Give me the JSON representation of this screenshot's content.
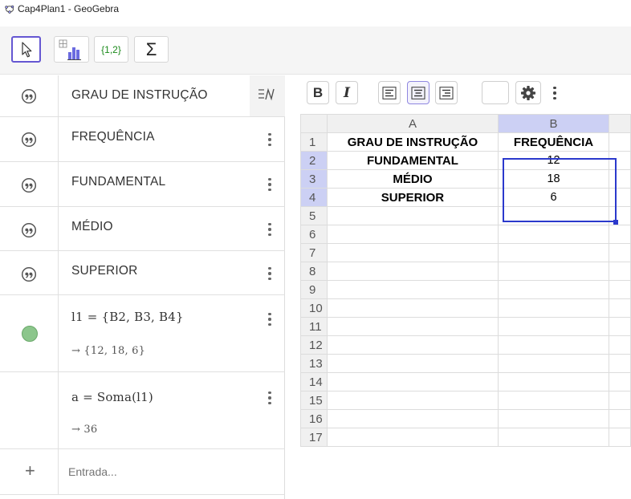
{
  "window": {
    "title": "Cap4Plan1 - GeoGebra"
  },
  "toolbar": {
    "tools": [
      {
        "name": "move",
        "icon": "cursor-arrow-icon",
        "active": true
      },
      {
        "name": "chart",
        "icon": "bar-chart-icon"
      },
      {
        "name": "list",
        "icon": "list-icon",
        "label": "{1,2}"
      },
      {
        "name": "sum",
        "icon": "sigma-icon",
        "label": "Σ"
      }
    ]
  },
  "algebra": {
    "items": [
      {
        "icon": "quote-icon",
        "text": "GRAU DE INSTRUÇÃO"
      },
      {
        "icon": "quote-icon",
        "text": "FREQUÊNCIA"
      },
      {
        "icon": "quote-icon",
        "text": "FUNDAMENTAL"
      },
      {
        "icon": "quote-icon",
        "text": "MÉDIO"
      },
      {
        "icon": "quote-icon",
        "text": "SUPERIOR"
      },
      {
        "icon": "green-marble",
        "definition": "l1 = {B2, B3, B4}",
        "value": "→ {12, 18, 6}"
      },
      {
        "definition": "a = Soma(l1)",
        "value": "→ 36"
      }
    ],
    "input": {
      "placeholder": "Entrada..."
    }
  },
  "spreadsheet": {
    "toolbar": {
      "bold": "B",
      "italic": "I",
      "align_left": "align-left-icon",
      "align_center": "align-center-icon",
      "align_right": "align-right-icon",
      "settings": "gear-icon"
    },
    "columns": [
      "A",
      "B"
    ],
    "rows": [
      {
        "n": "1",
        "a": "GRAU DE INSTRUÇÃO",
        "b": "FREQUÊNCIA"
      },
      {
        "n": "2",
        "a": "FUNDAMENTAL",
        "b": "12"
      },
      {
        "n": "3",
        "a": "MÉDIO",
        "b": "18"
      },
      {
        "n": "4",
        "a": "SUPERIOR",
        "b": "6"
      },
      {
        "n": "5"
      },
      {
        "n": "6"
      },
      {
        "n": "7"
      },
      {
        "n": "8"
      },
      {
        "n": "9"
      },
      {
        "n": "10"
      },
      {
        "n": "11"
      },
      {
        "n": "12"
      },
      {
        "n": "13"
      },
      {
        "n": "14"
      },
      {
        "n": "15"
      },
      {
        "n": "16"
      },
      {
        "n": "17"
      }
    ],
    "selected_range": "B2:B4",
    "colors": {
      "selection": "#2b39cc",
      "selected_header": "#ccd0f4"
    }
  }
}
